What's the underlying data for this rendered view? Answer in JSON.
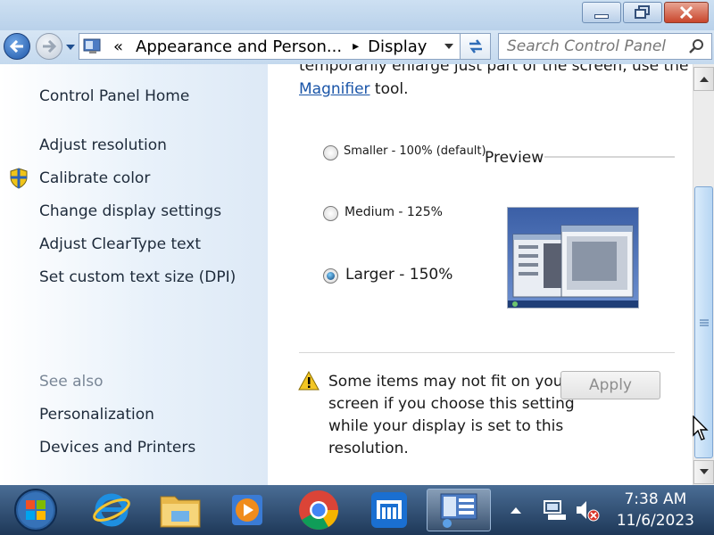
{
  "window": {
    "minimize_icon": "minimize-icon",
    "maximize_icon": "restore-icon",
    "close_icon": "close-icon"
  },
  "nav": {
    "breadcrumb_prefix": "«",
    "breadcrumb_parent": "Appearance and Person...",
    "breadcrumb_sep": "▸",
    "breadcrumb_current": "Display",
    "search_placeholder": "Search Control Panel"
  },
  "sidebar": {
    "home": "Control Panel Home",
    "links": [
      "Adjust resolution",
      "Calibrate color",
      "Change display settings",
      "Adjust ClearType text",
      "Set custom text size (DPI)"
    ],
    "see_also_label": "See also",
    "see_also": [
      "Personalization",
      "Devices and Printers"
    ]
  },
  "main": {
    "intro_partial": "temporarily enlarge just part of the screen, use the",
    "magnifier_link": "Magnifier",
    "tool_suffix": " tool.",
    "preview_label": "Preview",
    "options": [
      {
        "label": "Smaller - 100% (default)",
        "selected": false
      },
      {
        "label": "Medium - 125%",
        "selected": false
      },
      {
        "label": "Larger - 150%",
        "selected": true
      }
    ],
    "warning_lines": [
      "Some items may not fit on your",
      "screen if you choose this setting",
      "while your display is set to this",
      "resolution."
    ],
    "apply_label": "Apply"
  },
  "taskbar": {
    "apps": [
      "start-orb-icon",
      "internet-explorer-icon",
      "file-explorer-icon",
      "media-player-icon",
      "chrome-icon",
      "maxthon-icon",
      "control-panel-icon"
    ],
    "time": "7:38 AM",
    "date": "11/6/2023"
  },
  "colors": {
    "accent_link": "#1a55a8",
    "taskbar": "#2b4a70",
    "titlebar": "#c4d9ee"
  }
}
